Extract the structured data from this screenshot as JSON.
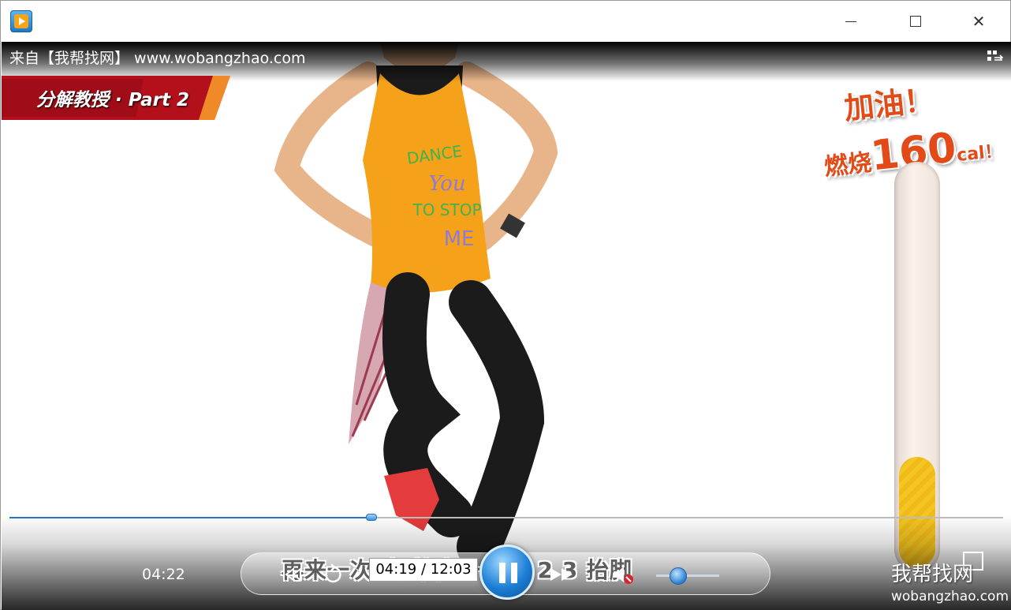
{
  "window": {
    "controls": {
      "minimize": "—",
      "maximize": "☐",
      "close": "✕"
    }
  },
  "overlay": {
    "source": "来自【我帮找网】 www.wobangzhao.com"
  },
  "video": {
    "banner": "分解教授 · Part 2",
    "cheer": "加油！",
    "burn_prefix": "燃烧",
    "burn_value": "160",
    "burn_unit": "cal",
    "burn_suffix": "！",
    "meter_level": 0.27,
    "shirt_text": "DANCE YOU TO STOP ME"
  },
  "player": {
    "elapsed": "04:22",
    "subtitle": "再来一次 大 抬高一点 1 2 3 抬脚",
    "time_tooltip": "04:19 / 12:03",
    "progress_fraction": 0.364,
    "volume_fraction": 0.35,
    "icons": [
      "rewind-icon",
      "replay-icon",
      "pause-icon",
      "forward-icon",
      "volume-icon",
      "fullscreen-icon",
      "playlist-icon"
    ]
  },
  "watermark": {
    "main": "我帮找网",
    "sub": "wobangzhao.com"
  },
  "colors": {
    "accent": "#1e78d0",
    "banner_red": "#b3101c",
    "cheer_orange": "#e24a17",
    "meter_yellow": "#f3c623"
  }
}
